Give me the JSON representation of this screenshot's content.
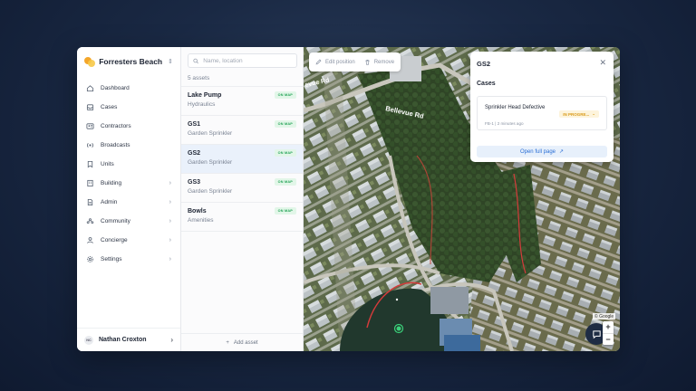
{
  "org": {
    "name": "Forresters Beach"
  },
  "nav": [
    {
      "key": "dashboard",
      "label": "Dashboard",
      "icon": "home-icon",
      "chevron": false
    },
    {
      "key": "cases",
      "label": "Cases",
      "icon": "inbox-icon",
      "chevron": false
    },
    {
      "key": "contractors",
      "label": "Contractors",
      "icon": "contact-card-icon",
      "chevron": false
    },
    {
      "key": "broadcasts",
      "label": "Broadcasts",
      "icon": "broadcast-icon",
      "chevron": false
    },
    {
      "key": "units",
      "label": "Units",
      "icon": "bookmark-icon",
      "chevron": false
    },
    {
      "key": "building",
      "label": "Building",
      "icon": "building-icon",
      "chevron": true
    },
    {
      "key": "admin",
      "label": "Admin",
      "icon": "document-icon",
      "chevron": true
    },
    {
      "key": "community",
      "label": "Community",
      "icon": "community-icon",
      "chevron": true
    },
    {
      "key": "concierge",
      "label": "Concierge",
      "icon": "person-icon",
      "chevron": true
    },
    {
      "key": "settings",
      "label": "Settings",
      "icon": "gear-icon",
      "chevron": true
    }
  ],
  "user": {
    "initials": "NC",
    "name": "Nathan Croxton"
  },
  "search": {
    "placeholder": "Name, location",
    "value": ""
  },
  "asset_count": "5 assets",
  "assets": [
    {
      "name": "Lake Pump",
      "type": "Hydraulics",
      "badge": "ON MAP",
      "selected": false
    },
    {
      "name": "GS1",
      "type": "Garden Sprinkler",
      "badge": "ON MAP",
      "selected": false
    },
    {
      "name": "GS2",
      "type": "Garden Sprinkler",
      "badge": "ON MAP",
      "selected": true
    },
    {
      "name": "GS3",
      "type": "Garden Sprinkler",
      "badge": "ON MAP",
      "selected": false
    },
    {
      "name": "Bowls",
      "type": "Amenities",
      "badge": "ON MAP",
      "selected": false
    }
  ],
  "add_asset_label": "Add asset",
  "map": {
    "toolbar": {
      "edit_label": "Edit position",
      "remove_label": "Remove"
    },
    "road_labels": [
      "Bellevue Rd",
      "evue Rd"
    ],
    "attribution": "© Google"
  },
  "panel": {
    "title": "GS2",
    "section": "Cases",
    "case": {
      "title": "Sprinkler Head Defective",
      "meta": "FB-1 | 2 minutes ago",
      "status": "IN PROGRE..."
    },
    "open_label": "Open full page"
  },
  "colors": {
    "accent": "#2b6fd6",
    "on_map": "#23a356",
    "in_progress": "#d99a1a",
    "selected_row": "#eaf1fb"
  }
}
